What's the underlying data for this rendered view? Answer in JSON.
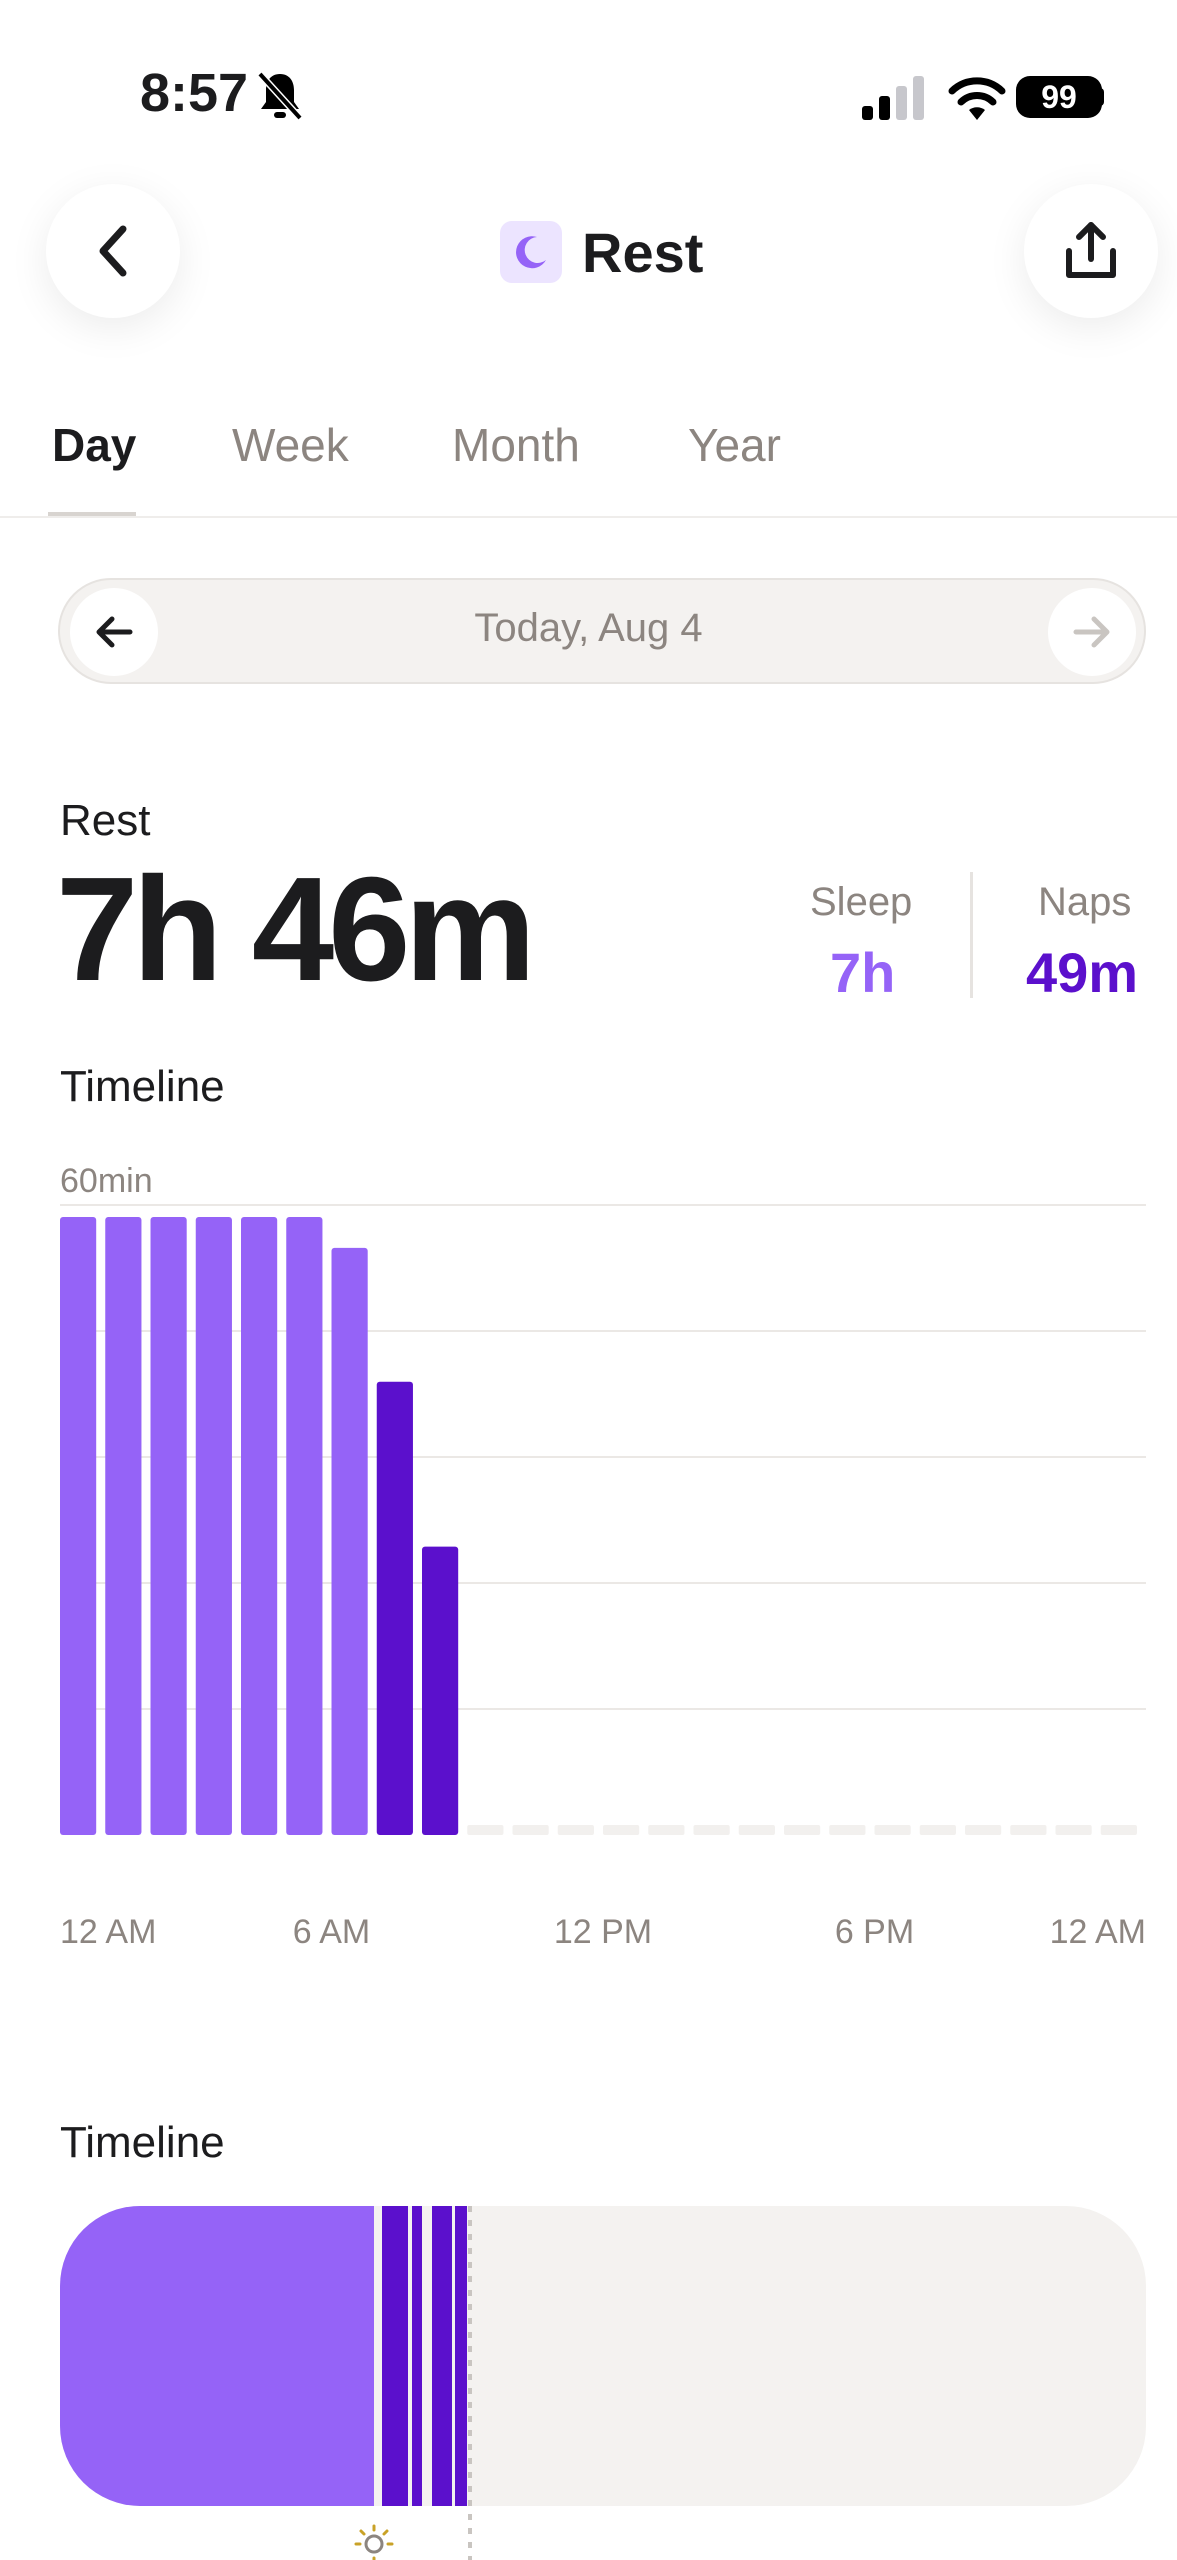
{
  "status_bar": {
    "time": "8:57",
    "battery": "99"
  },
  "header": {
    "title": "Rest",
    "icon": "moon-icon",
    "back_icon": "chevron-left-icon",
    "share_icon": "share-icon"
  },
  "tabs": [
    {
      "label": "Day",
      "active": true
    },
    {
      "label": "Week",
      "active": false
    },
    {
      "label": "Month",
      "active": false
    },
    {
      "label": "Year",
      "active": false
    }
  ],
  "date_picker": {
    "label": "Today, Aug 4"
  },
  "summary": {
    "label": "Rest",
    "total": "7h 46m",
    "sleep": {
      "label": "Sleep",
      "value": "7h",
      "color": "#9563f7"
    },
    "naps": {
      "label": "Naps",
      "value": "49m",
      "color": "#5b10cc"
    }
  },
  "timeline_chart": {
    "title": "Timeline",
    "y_max_label": "60min",
    "x_tick_labels": [
      "12 AM",
      "6 AM",
      "12 PM",
      "6 PM",
      "12 AM"
    ]
  },
  "chart_data": {
    "type": "bar",
    "ylim": [
      0,
      60
    ],
    "categories": [
      "0",
      "1",
      "2",
      "3",
      "4",
      "5",
      "6",
      "7",
      "8"
    ],
    "series": [
      {
        "name": "Sleep",
        "color": "#9563f7",
        "values": [
          60,
          60,
          60,
          60,
          60,
          60,
          57,
          0,
          0
        ]
      },
      {
        "name": "Naps",
        "color": "#5b10cc",
        "values": [
          0,
          0,
          0,
          0,
          0,
          0,
          0,
          44,
          28
        ]
      }
    ],
    "hours_in_day": 24,
    "grid": true
  },
  "timeline_strip": {
    "title": "Timeline",
    "sleep_color": "#9563f7",
    "nap_color": "#5b10cc",
    "empty_color": "#f4f2f0",
    "sun_icon": "sun-icon"
  }
}
